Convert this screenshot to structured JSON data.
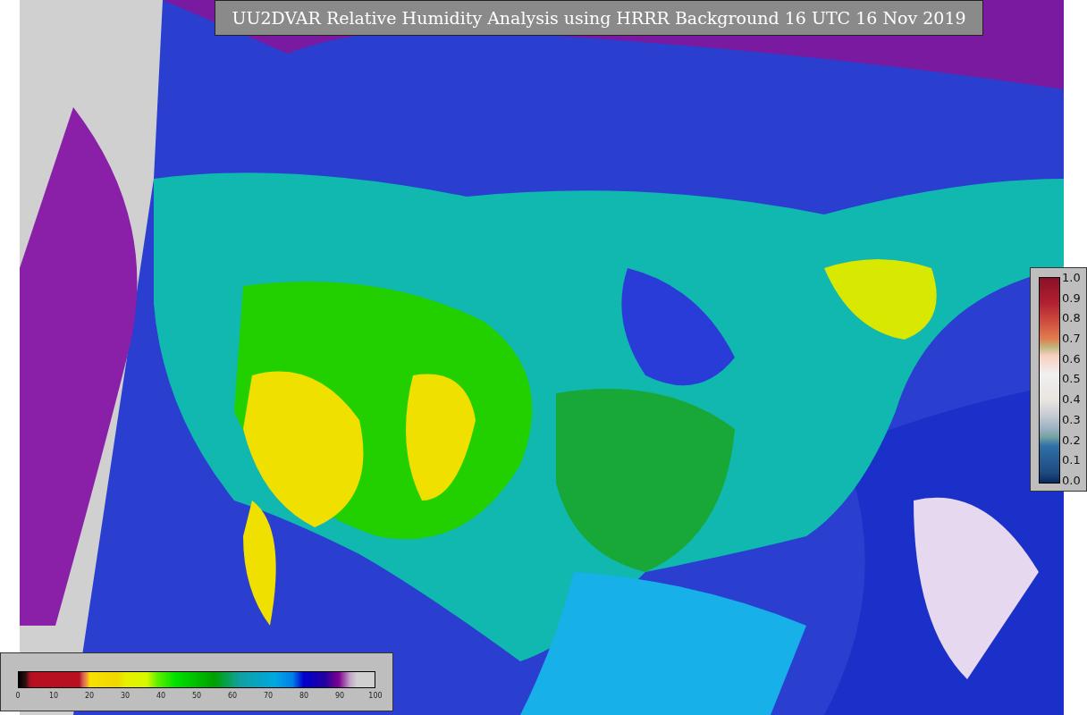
{
  "title": "UU2DVAR Relative Humidity Analysis using HRRR Background 16 UTC 16 Nov 2019",
  "humidity_colorbar": {
    "ticks": [
      "0",
      "10",
      "20",
      "30",
      "40",
      "50",
      "60",
      "70",
      "80",
      "90",
      "100"
    ]
  },
  "weight_colorbar": {
    "ticks": [
      "1.0",
      "0.9",
      "0.8",
      "0.7",
      "0.6",
      "0.5",
      "0.4",
      "0.3",
      "0.2",
      "0.1",
      "0.0"
    ]
  }
}
